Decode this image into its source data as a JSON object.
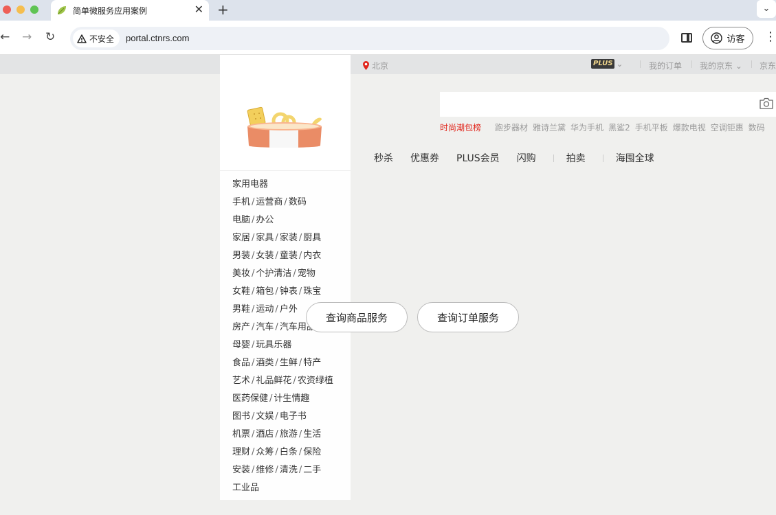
{
  "browser": {
    "tab_title": "简单微服务应用案例",
    "tab_close": "✕",
    "new_tab": "+",
    "tab_menu": "⌄",
    "security_label": "不安全",
    "url": "portal.ctnrs.com",
    "profile_label": "访客"
  },
  "topbar": {
    "location": "北京",
    "plus": "PLUS",
    "links": [
      "我的订单",
      "我的京东",
      "京东"
    ]
  },
  "search": {
    "hot": "时尚潮包榜",
    "hotwords": [
      "跑步器材",
      "雅诗兰黛",
      "华为手机",
      "黑鲨2",
      "手机平板",
      "爆款电视",
      "空调钜惠",
      "数码"
    ]
  },
  "nav": [
    "秒杀",
    "优惠券",
    "PLUS会员",
    "闪购",
    "拍卖",
    "海囤全球"
  ],
  "categories": [
    [
      "家用电器"
    ],
    [
      "手机",
      "运营商",
      "数码"
    ],
    [
      "电脑",
      "办公"
    ],
    [
      "家居",
      "家具",
      "家装",
      "厨具"
    ],
    [
      "男装",
      "女装",
      "童装",
      "内衣"
    ],
    [
      "美妆",
      "个护清洁",
      "宠物"
    ],
    [
      "女鞋",
      "箱包",
      "钟表",
      "珠宝"
    ],
    [
      "男鞋",
      "运动",
      "户外"
    ],
    [
      "房产",
      "汽车",
      "汽车用品"
    ],
    [
      "母婴",
      "玩具乐器"
    ],
    [
      "食品",
      "酒类",
      "生鲜",
      "特产"
    ],
    [
      "艺术",
      "礼品鲜花",
      "农资绿植"
    ],
    [
      "医药保健",
      "计生情趣"
    ],
    [
      "图书",
      "文娱",
      "电子书"
    ],
    [
      "机票",
      "酒店",
      "旅游",
      "生活"
    ],
    [
      "理财",
      "众筹",
      "白条",
      "保险"
    ],
    [
      "安装",
      "维修",
      "清洗",
      "二手"
    ],
    [
      "工业品"
    ]
  ],
  "buttons": {
    "goods": "查询商品服务",
    "orders": "查询订单服务"
  },
  "colors": {
    "hot": "#e1251b",
    "location_pin": "#e1251b",
    "page_bg": "#f0f0ee"
  }
}
